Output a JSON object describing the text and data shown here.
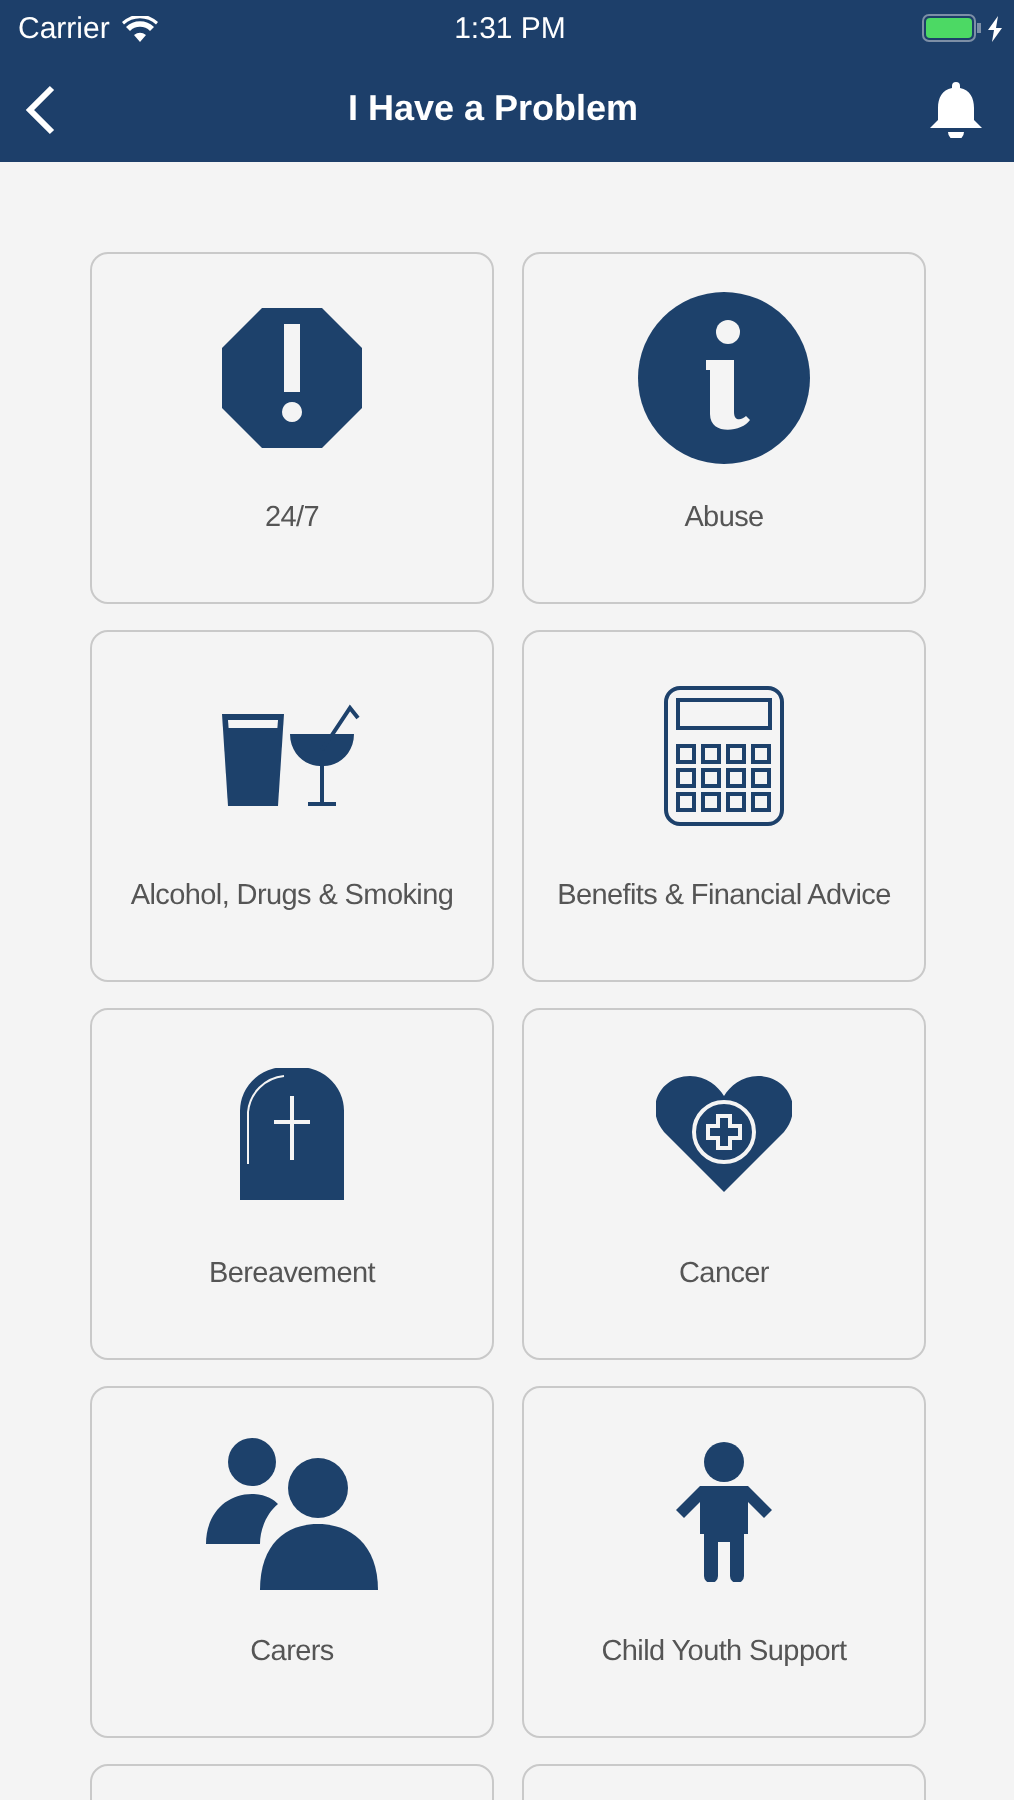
{
  "status_bar": {
    "carrier": "Carrier",
    "time": "1:31 PM"
  },
  "nav_bar": {
    "title": "I Have a Problem"
  },
  "tiles": [
    {
      "label": "24/7",
      "kind": "alert"
    },
    {
      "label": "Abuse",
      "kind": "info"
    },
    {
      "label": "Alcohol, Drugs & Smoking",
      "kind": "drinks"
    },
    {
      "label": "Benefits & Financial Advice",
      "kind": "calculator"
    },
    {
      "label": "Bereavement",
      "kind": "gravestone"
    },
    {
      "label": "Cancer",
      "kind": "heart"
    },
    {
      "label": "Carers",
      "kind": "people"
    },
    {
      "label": "Child Youth Support",
      "kind": "child"
    },
    {
      "kind": "blank"
    },
    {
      "kind": "blank"
    }
  ]
}
